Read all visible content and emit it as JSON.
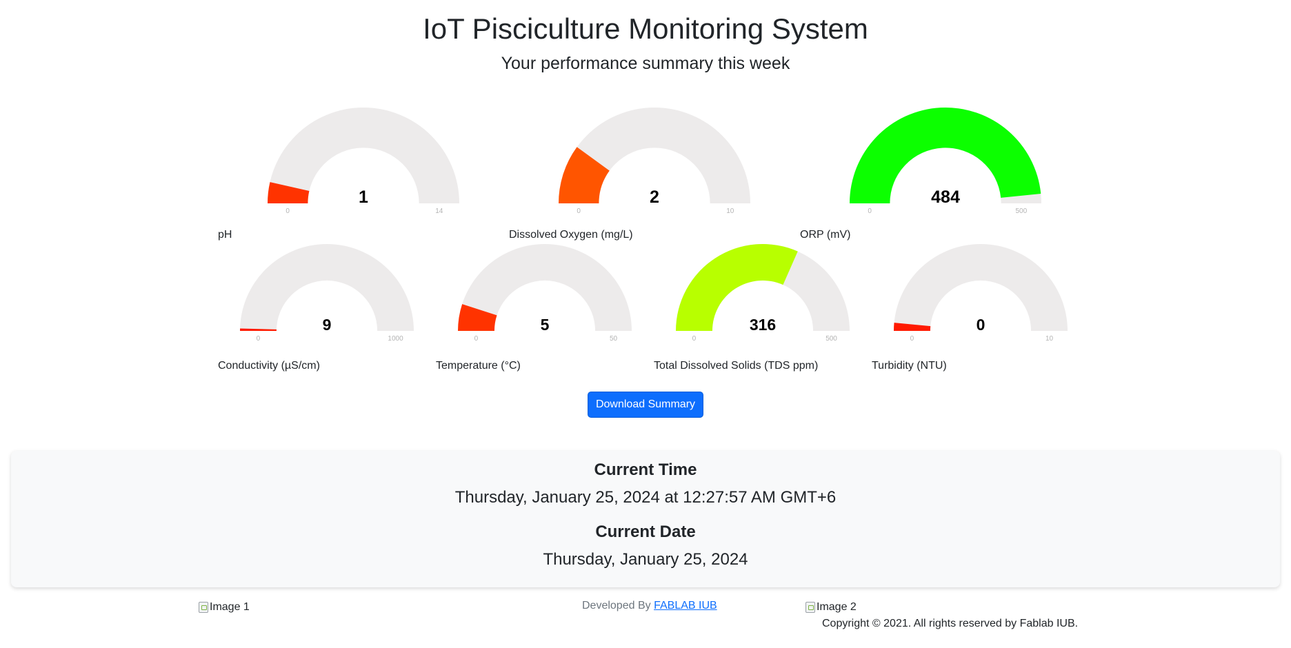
{
  "header": {
    "title": "IoT Pisciculture Monitoring System",
    "subtitle": "Your performance summary this week"
  },
  "gauges": [
    {
      "label": "pH",
      "value": 1,
      "display": "1",
      "min": 0,
      "max": 14,
      "min_label": "0",
      "max_label": "14",
      "color": "#ff3300"
    },
    {
      "label": "Dissolved Oxygen (mg/L)",
      "value": 2,
      "display": "2",
      "min": 0,
      "max": 10,
      "min_label": "0",
      "max_label": "10",
      "color": "#ff5500"
    },
    {
      "label": "ORP (mV)",
      "value": 484,
      "display": "484",
      "min": 0,
      "max": 500,
      "min_label": "0",
      "max_label": "500",
      "color": "#0cff00"
    },
    {
      "label": "Conductivity (µS/cm)",
      "value": 9,
      "display": "9",
      "min": 0,
      "max": 1000,
      "min_label": "0",
      "max_label": "1000",
      "color": "#ff1a00"
    },
    {
      "label": "Temperature (°C)",
      "value": 5,
      "display": "5",
      "min": 0,
      "max": 50,
      "min_label": "0",
      "max_label": "50",
      "color": "#ff3300"
    },
    {
      "label": "Total Dissolved Solids (TDS ppm)",
      "value": 316,
      "display": "316",
      "min": 0,
      "max": 500,
      "min_label": "0",
      "max_label": "500",
      "color": "#b8ff00"
    },
    {
      "label": "Turbidity (NTU)",
      "value": 0.3,
      "display": "0",
      "min": 0,
      "max": 10,
      "min_label": "0",
      "max_label": "10",
      "color": "#ff1a00"
    }
  ],
  "colors": {
    "track": "#edebeb",
    "primary": "#0d6efd",
    "card_bg": "#f8f9fa"
  },
  "actions": {
    "download_label": "Download Summary"
  },
  "time_card": {
    "time_heading": "Current Time",
    "time_value": "Thursday, January 25, 2024 at 12:27:57 AM GMT+6",
    "date_heading": "Current Date",
    "date_value": "Thursday, January 25, 2024"
  },
  "footer": {
    "image1_alt": "Image 1",
    "image2_alt": "Image 2",
    "developed_by": "Developed By",
    "dev_link": "FABLAB IUB",
    "copyright": "Copyright © 2021. All rights reserved by Fablab IUB."
  }
}
